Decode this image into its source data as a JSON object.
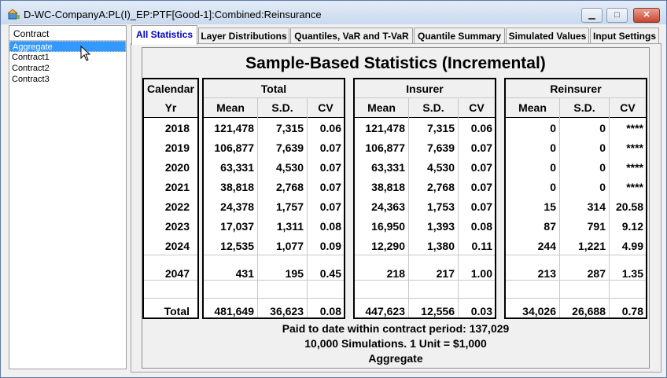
{
  "window": {
    "title": "D-WC-CompanyA:PL(I)_EP:PTF[Good-1]:Combined:Reinsurance",
    "minimize": "▁",
    "maximize": "□",
    "close": "✕"
  },
  "list": {
    "header": "Contract",
    "items": [
      "Aggregate",
      "Contract1",
      "Contract2",
      "Contract3"
    ],
    "selected_index": 0
  },
  "tabs": [
    {
      "label": "All Statistics",
      "active": true
    },
    {
      "label": "Layer Distributions",
      "active": false
    },
    {
      "label": "Quantiles, VaR and T-VaR",
      "active": false
    },
    {
      "label": "Quantile Summary",
      "active": false
    },
    {
      "label": "Simulated Values",
      "active": false
    },
    {
      "label": "Input Settings",
      "active": false
    }
  ],
  "report": {
    "heading": "Sample-Based Statistics (Incremental)",
    "year_header_top": "Calendar",
    "year_header_bottom": "Yr",
    "groups": [
      "Total",
      "Insurer",
      "Reinsurer"
    ],
    "sub_headers": [
      "Mean",
      "S.D.",
      "CV"
    ],
    "rows": [
      {
        "yr": "2018",
        "v": [
          "121,478",
          "7,315",
          "0.06",
          "121,478",
          "7,315",
          "0.06",
          "0",
          "0",
          "****"
        ]
      },
      {
        "yr": "2019",
        "v": [
          "106,877",
          "7,639",
          "0.07",
          "106,877",
          "7,639",
          "0.07",
          "0",
          "0",
          "****"
        ]
      },
      {
        "yr": "2020",
        "v": [
          "63,331",
          "4,530",
          "0.07",
          "63,331",
          "4,530",
          "0.07",
          "0",
          "0",
          "****"
        ]
      },
      {
        "yr": "2021",
        "v": [
          "38,818",
          "2,768",
          "0.07",
          "38,818",
          "2,768",
          "0.07",
          "0",
          "0",
          "****"
        ]
      },
      {
        "yr": "2022",
        "v": [
          "24,378",
          "1,757",
          "0.07",
          "24,363",
          "1,753",
          "0.07",
          "15",
          "314",
          "20.58"
        ]
      },
      {
        "yr": "2023",
        "v": [
          "17,037",
          "1,311",
          "0.08",
          "16,950",
          "1,393",
          "0.08",
          "87",
          "791",
          "9.12"
        ]
      },
      {
        "yr": "2024",
        "v": [
          "12,535",
          "1,077",
          "0.09",
          "12,290",
          "1,380",
          "0.11",
          "244",
          "1,221",
          "4.99"
        ]
      },
      {
        "yr": "2047",
        "v": [
          "431",
          "195",
          "0.45",
          "218",
          "217",
          "1.00",
          "213",
          "287",
          "1.35"
        ]
      },
      {
        "yr": "Total",
        "v": [
          "481,649",
          "36,623",
          "0.08",
          "447,623",
          "12,556",
          "0.03",
          "34,026",
          "26,688",
          "0.78"
        ]
      }
    ],
    "footer": [
      "Paid to date within contract period: 137,029",
      "10,000 Simulations. 1 Unit = $1,000",
      "Aggregate"
    ]
  }
}
